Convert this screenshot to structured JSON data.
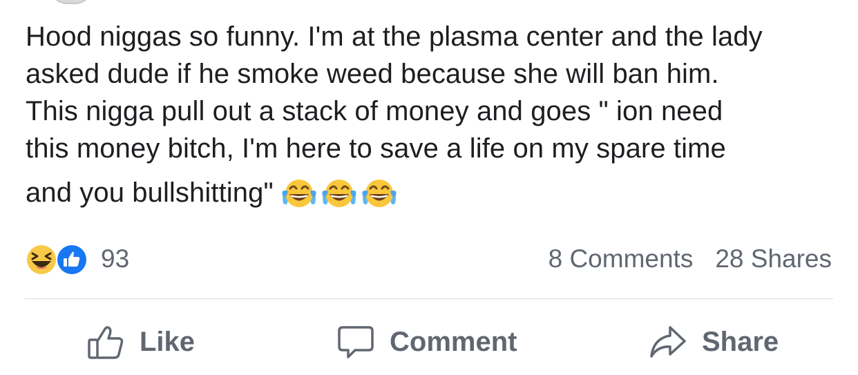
{
  "post": {
    "lines": [
      "Hood niggas so funny. I'm at the plasma center and the lady",
      "asked dude if he smoke weed because she will ban him.",
      "This nigga pull out a stack of money and goes \" ion need",
      "this money bitch, I'm here to save a life on my spare time",
      "and you bullshitting\""
    ],
    "emojis": [
      "face-with-tears-of-joy-icon",
      "face-with-tears-of-joy-icon",
      "face-with-tears-of-joy-icon"
    ]
  },
  "reactions": {
    "types": [
      "haha-icon",
      "like-icon"
    ],
    "count": "93"
  },
  "stats": {
    "comments": "8 Comments",
    "shares": "28 Shares"
  },
  "actions": {
    "like": "Like",
    "comment": "Comment",
    "share": "Share"
  },
  "colors": {
    "text": "#1c1e21",
    "secondary": "#606770",
    "like_blue": "#1877f2",
    "haha_yellow": "#f7b125",
    "divider": "#dadde1"
  }
}
